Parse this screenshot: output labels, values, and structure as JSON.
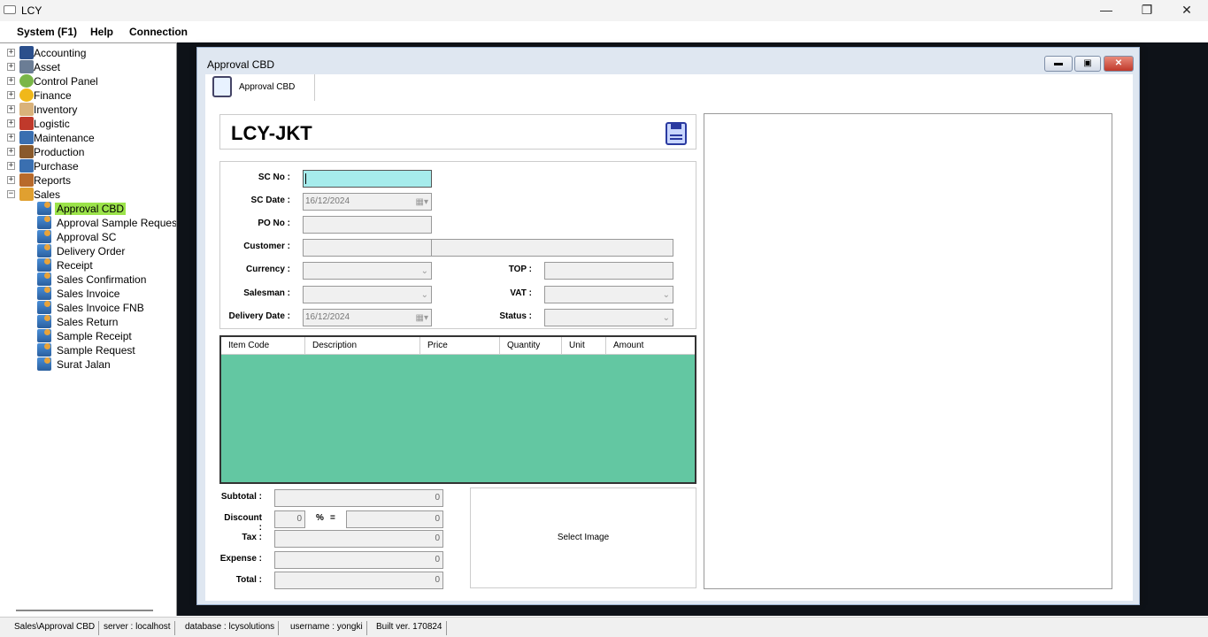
{
  "window": {
    "title": "LCY"
  },
  "menu": [
    "System (F1)",
    "Help",
    "Connection"
  ],
  "tree": {
    "roots": [
      "Accounting",
      "Asset",
      "Control Panel",
      "Finance",
      "Inventory",
      "Logistic",
      "Maintenance",
      "Production",
      "Purchase",
      "Reports",
      "Sales"
    ],
    "sales_children": [
      "Approval CBD",
      "Approval Sample Reques",
      "Approval SC",
      "Delivery Order",
      "Receipt",
      "Sales Confirmation",
      "Sales Invoice",
      "Sales Invoice FNB",
      "Sales Return",
      "Sample Receipt",
      "Sample Request",
      "Surat Jalan"
    ],
    "selected": "Approval CBD"
  },
  "mdi": {
    "title": "Approval CBD",
    "tab_label": "Approval CBD"
  },
  "form": {
    "company": "LCY-JKT",
    "labels": {
      "sc_no": "SC No :",
      "sc_date": "SC Date :",
      "po_no": "PO No :",
      "customer": "Customer :",
      "currency": "Currency :",
      "salesman": "Salesman :",
      "delivery_date": "Delivery Date :",
      "top": "TOP :",
      "vat": "VAT :",
      "status": "Status :"
    },
    "values": {
      "sc_date": "16/12/2024",
      "delivery_date": "16/12/2024"
    }
  },
  "grid": {
    "columns": [
      "Item Code",
      "Description",
      "Price",
      "Quantity",
      "Unit",
      "Amount"
    ]
  },
  "totals": {
    "labels": {
      "subtotal": "Subtotal :",
      "discount": "Discount :",
      "tax": "Tax :",
      "expense": "Expense :",
      "total": "Total :"
    },
    "subtotal": "0",
    "discount_pct": "0",
    "discount_amt": "0",
    "tax": "0",
    "expense": "0",
    "total": "0",
    "pct_symbol": "%",
    "eq_symbol": "="
  },
  "image": {
    "select_label": "Select Image"
  },
  "status": {
    "path": "Sales\\Approval CBD",
    "server": "server : localhost",
    "database": "database : lcysolutions",
    "username": "username : yongki",
    "build": "Built ver. 170824"
  },
  "colors": {
    "selected_tree": "#9be34a",
    "grid_bg": "#63c7a2",
    "active_field": "#a6ecec"
  }
}
